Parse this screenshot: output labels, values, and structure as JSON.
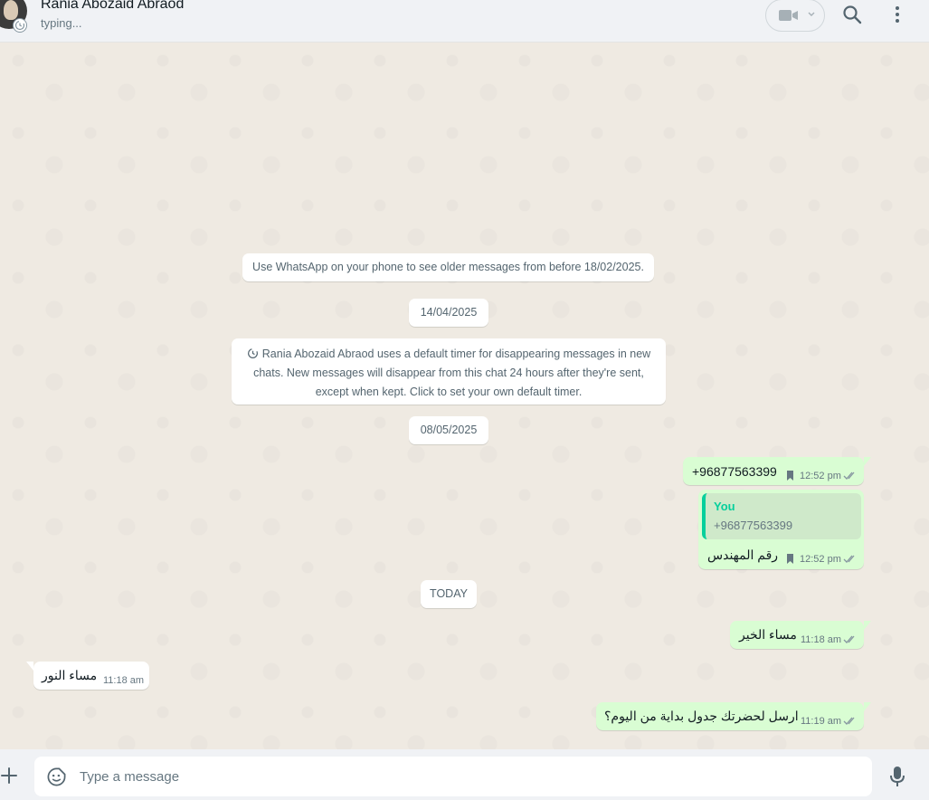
{
  "header": {
    "contact_name": "Rania Abozaid Abraod",
    "status": "typing..."
  },
  "chat": {
    "system_notice": "Use WhatsApp on your phone to see older messages from before 18/02/2025.",
    "date_1": "14/04/2025",
    "timer_notice": "Rania Abozaid Abraod uses a default timer for disappearing messages in new chats. New messages will disappear from this chat 24 hours after they're sent, except when kept. Click to set your own default timer.",
    "date_2": "08/05/2025",
    "date_today": "TODAY",
    "messages": [
      {
        "direction": "out",
        "text": "+96877563399",
        "time": "12:52 pm"
      },
      {
        "direction": "out",
        "quote_author": "You",
        "quote_text": "+96877563399",
        "text": "رقم المهندس",
        "time": "12:52 pm"
      },
      {
        "direction": "out",
        "text": "مساء الخير",
        "time": "11:18 am"
      },
      {
        "direction": "in",
        "text": "مساء النور",
        "time": "11:18 am"
      },
      {
        "direction": "out",
        "text": "ارسل لحضرتك جدول بداية من اليوم؟",
        "time": "11:19 am"
      }
    ]
  },
  "composer": {
    "placeholder": "Type a message"
  },
  "colors": {
    "outgoing_bubble": "#d9fdd3",
    "incoming_bubble": "#ffffff",
    "chat_background": "#efeae2",
    "accent": "#06cf9c"
  }
}
